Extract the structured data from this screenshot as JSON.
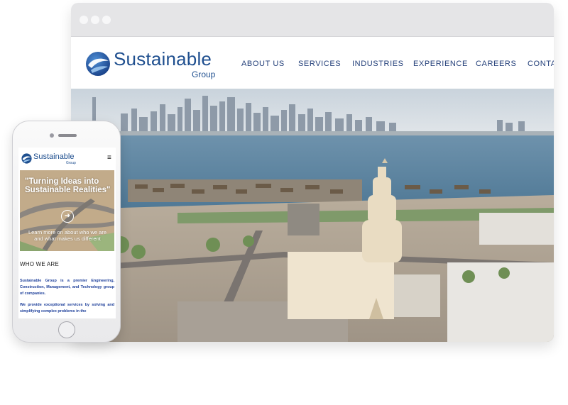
{
  "desktop": {
    "logo": {
      "main": "Sustainable",
      "sub": "Group"
    },
    "nav": [
      {
        "label": "ABOUT US"
      },
      {
        "label": "SERVICES"
      },
      {
        "label": "INDUSTRIES"
      },
      {
        "label": "EXPERIENCE"
      },
      {
        "label": "CAREERS"
      },
      {
        "label": "CONTA"
      }
    ]
  },
  "mobile": {
    "logo": {
      "main": "Sustainable",
      "sub": "Group"
    },
    "menu_icon": "hamburger-icon",
    "menu_glyph": "≡",
    "hero": {
      "title": "\"Turning Ideas into Sustainable Realities\"",
      "subtitle": "Learn more on about who we are and what makes us different",
      "arrow_glyph": "➜"
    },
    "section_title": "WHO WE ARE",
    "paragraphs": [
      "Sustainable Group is a premier Engineering, Construction, Management, and Technology group of companies.",
      "We provide exceptional services by solving and simplifying complex problems in the"
    ]
  },
  "colors": {
    "brand_blue": "#1f4f8f",
    "nav_text": "#24407a",
    "browser_chrome": "#e5e5e7"
  }
}
